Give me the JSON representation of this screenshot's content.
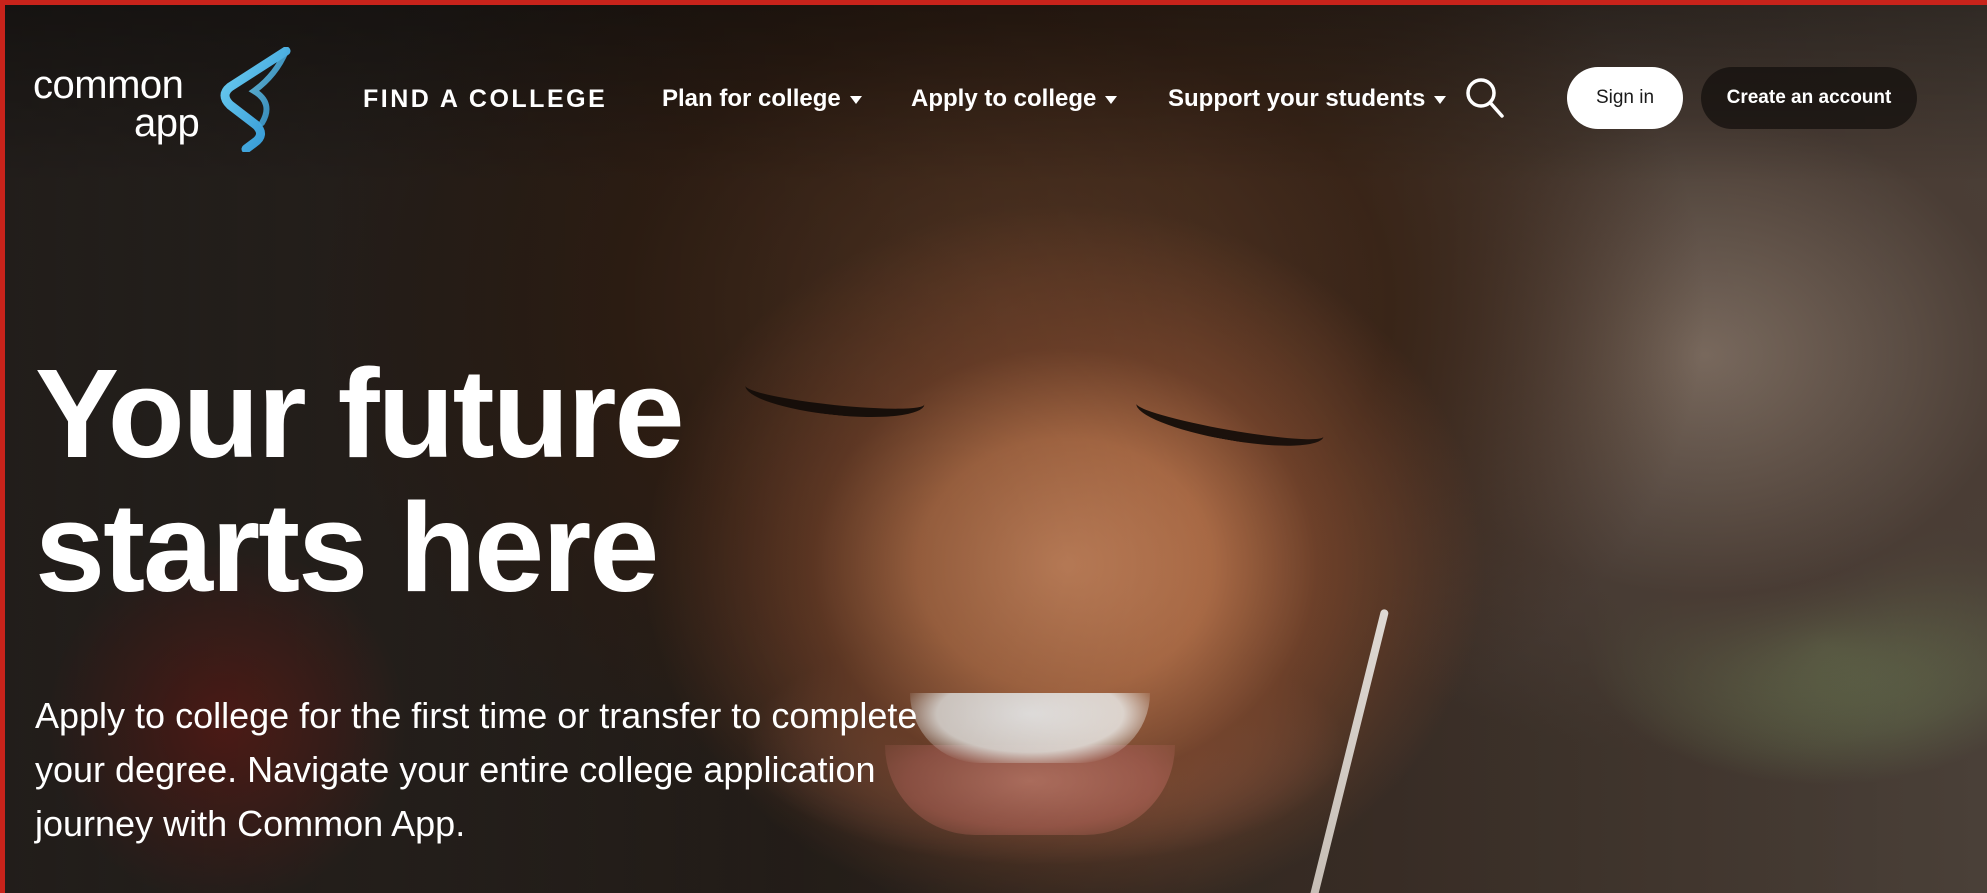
{
  "logo": {
    "line1": "common",
    "line2": "app",
    "accent_color": "#3fb4e6"
  },
  "nav": {
    "find_college": "FIND A COLLEGE",
    "items": [
      {
        "label": "Plan for college"
      },
      {
        "label": "Apply to college"
      },
      {
        "label": "Support your students"
      }
    ],
    "search_icon": "search-icon",
    "sign_in": "Sign in",
    "create_account": "Create an account"
  },
  "hero": {
    "headline_line1": "Your future",
    "headline_line2": "starts here",
    "subtext": "Apply to college for the first time or transfer to complete your degree. Navigate your entire college application journey with Common App."
  },
  "colors": {
    "frame_border": "#c8231b",
    "button_light": "#ffffff",
    "button_dark": "#14100e"
  }
}
